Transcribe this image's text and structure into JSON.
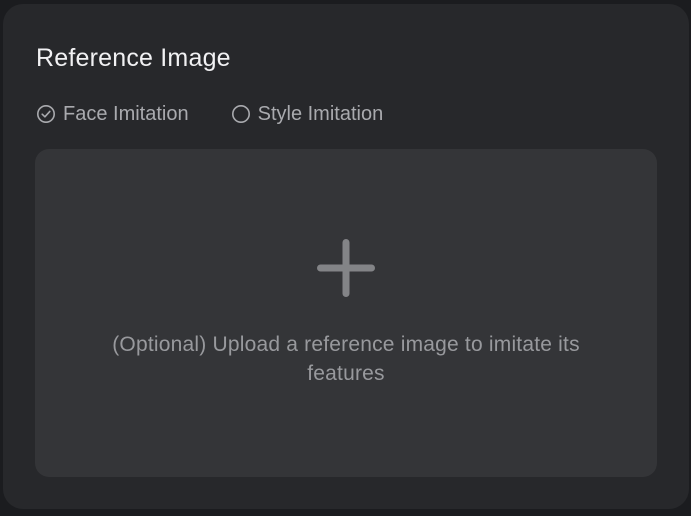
{
  "panel": {
    "title": "Reference Image"
  },
  "imitation_options": [
    {
      "label": "Face Imitation",
      "checked": true,
      "icon": "check-circle-icon"
    },
    {
      "label": "Style Imitation",
      "checked": false,
      "icon": "empty-circle-icon"
    }
  ],
  "upload": {
    "icon": "plus-icon",
    "hint": "(Optional) Upload a reference image to imitate its features"
  },
  "colors": {
    "background": "#27282b",
    "upload_area": "#343538",
    "title_text": "#f1f1f3",
    "option_text": "#a9aaae",
    "hint_text": "#98999d",
    "plus_icon": "#838487"
  }
}
